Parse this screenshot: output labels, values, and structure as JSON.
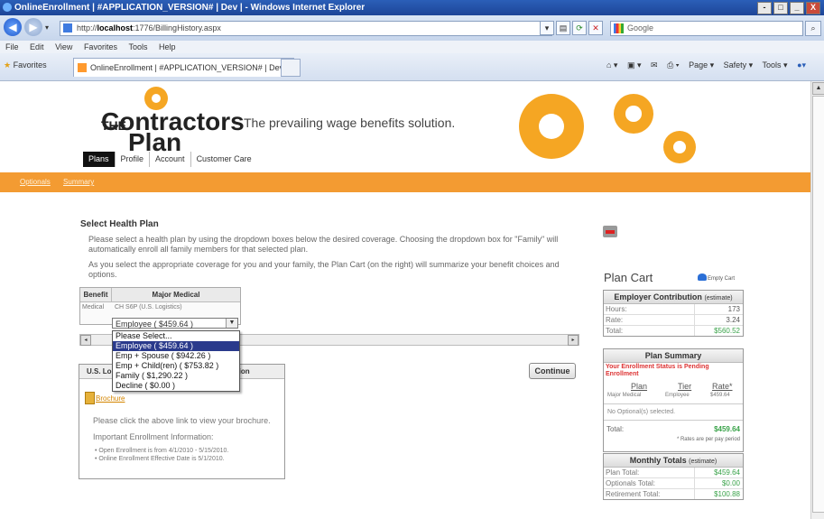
{
  "window": {
    "title": "OnlineEnrollment | #APPLICATION_VERSION# | Dev | - Windows Internet Explorer",
    "controls_right": [
      "-",
      "□",
      "_",
      "X"
    ]
  },
  "address_bar": {
    "url_prefix": "http://",
    "url_host": "localhost",
    "url_rest": ":1776/BillingHistory.aspx",
    "search_placeholder": "Google"
  },
  "menu": [
    "File",
    "Edit",
    "View",
    "Favorites",
    "Tools",
    "Help"
  ],
  "favorites_bar": {
    "favorites_label": "Favorites",
    "tab_title": "OnlineEnrollment | #APPLICATION_VERSION# | Dev |",
    "commands": [
      "Page ▾",
      "Safety ▾",
      "Tools ▾"
    ]
  },
  "header": {
    "logo_the": "THE",
    "logo_line1": "Contractors",
    "logo_line2": "Plan",
    "tagline": "The prevailing wage benefits solution.",
    "nav_tabs": [
      "Plans",
      "Profile",
      "Account",
      "Customer Care"
    ],
    "sub_tabs": [
      "Optionals",
      "Summary"
    ]
  },
  "main": {
    "heading": "Select Health Plan",
    "para1": "Please select a health plan by using the dropdown boxes below the desired coverage. Choosing the dropdown box for \"Family\" will automatically enroll all family members for that selected plan.",
    "para2": "As you select the appropriate coverage for you and your family, the Plan Cart (on the right) will summarize your benefit choices and options.",
    "table": {
      "headers": [
        "Benefit",
        "Major Medical"
      ],
      "row": [
        "Medical",
        "CH S6P (U.S. Logistics)"
      ]
    },
    "select_value": "Employee ( $459.64 )",
    "dropdown_options": [
      "Please Select...",
      "Employee ( $459.64 )",
      "Emp + Spouse ( $942.26 )",
      "Emp + Child(ren) ( $753.82 )",
      "Family ( $1,290.22 )",
      "Decline ( $0.00 )"
    ],
    "brochure": {
      "header_left": "U.S. Lo",
      "header_right": "tion",
      "link": "Brochure",
      "text": "Please click the above link to view your brochure.",
      "info_title": "Important Enrollment Information:",
      "bullets": [
        "Open Enrollment is from 4/1/2010 - 5/15/2010.",
        "Online Enrollment Effective Date is 5/1/2010."
      ]
    },
    "continue_label": "Continue"
  },
  "cart": {
    "title": "Plan Cart",
    "empty_label": "Empty Cart",
    "employer": {
      "title": "Employer Contribution",
      "title_note": "(estimate)",
      "rows": [
        {
          "k": "Hours:",
          "v": "173"
        },
        {
          "k": "Rate:",
          "v": "3.24"
        },
        {
          "k": "Total:",
          "v": "$560.52"
        }
      ]
    },
    "summary": {
      "title": "Plan Summary",
      "status": "Your Enrollment Status is Pending Enrollment",
      "col_heads": [
        "Plan",
        "Tier",
        "Rate*"
      ],
      "row": [
        "Major Medical",
        "Employee",
        "$459.64"
      ],
      "no_optionals": "No Optional(s) selected.",
      "total_label": "Total:",
      "total_value": "$459.64",
      "note": "* Rates are per pay period"
    },
    "monthly": {
      "title": "Monthly Totals",
      "title_note": "(estimate)",
      "rows": [
        {
          "k": "Plan Total:",
          "v": "$459.64"
        },
        {
          "k": "Optionals Total:",
          "v": "$0.00"
        },
        {
          "k": "Retirement Total:",
          "v": "$100.88"
        }
      ]
    }
  },
  "colors": {
    "orange": "#f39b32",
    "ie_blue": "#1d4597",
    "green_value": "#3aa34a",
    "status_red": "#d33"
  }
}
